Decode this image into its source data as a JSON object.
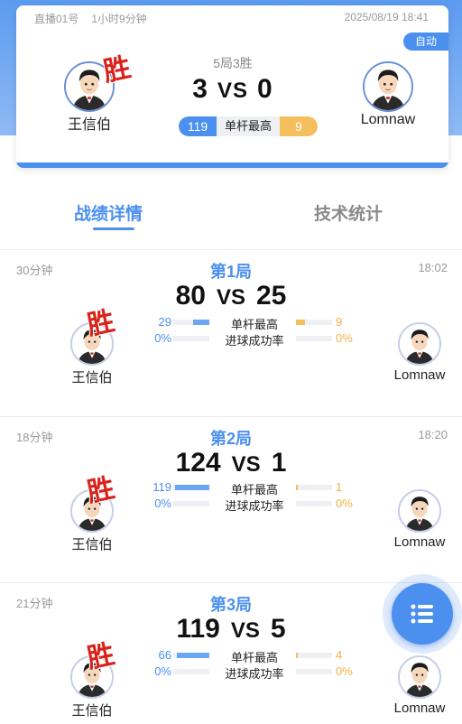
{
  "header": {
    "room": "直播01号",
    "duration": "1小时9分钟",
    "datetime": "2025/08/19 18:41",
    "auto_badge": "自动",
    "format": "5局3胜",
    "score_left": "3",
    "vs": "VS",
    "score_right": "0",
    "break_label": "单杆最高",
    "break_left": "119",
    "break_right": "9",
    "player_left": "王信伯",
    "player_right": "Lomnaw",
    "win_stamp": "胜"
  },
  "tabs": {
    "active": "战绩详情",
    "inactive": "技术统计"
  },
  "labels": {
    "high_break": "单杆最高",
    "pot_rate": "进球成功率",
    "vs": "VS",
    "win": "胜"
  },
  "games": [
    {
      "title": "第1局",
      "duration": "30分钟",
      "time": "18:02",
      "score_left": "80",
      "score_right": "25",
      "break_left": "29",
      "break_right": "9",
      "break_left_fill": 0.45,
      "break_right_fill": 0.25,
      "pot_left": "0%",
      "pot_right": "0%",
      "player_left": "王信伯",
      "player_right": "Lomnaw"
    },
    {
      "title": "第2局",
      "duration": "18分钟",
      "time": "18:20",
      "score_left": "124",
      "score_right": "1",
      "break_left": "119",
      "break_right": "1",
      "break_left_fill": 0.95,
      "break_right_fill": 0.05,
      "pot_left": "0%",
      "pot_right": "0%",
      "player_left": "王信伯",
      "player_right": "Lomnaw"
    },
    {
      "title": "第3局",
      "duration": "21分钟",
      "time": "",
      "score_left": "119",
      "score_right": "5",
      "break_left": "66",
      "break_right": "4",
      "break_left_fill": 0.9,
      "break_right_fill": 0.06,
      "pot_left": "0%",
      "pot_right": "0%",
      "player_left": "王信伯",
      "player_right": "Lomnaw"
    }
  ],
  "colors": {
    "accent": "#4b90ef",
    "win_red": "#d8231b",
    "gold": "#f5bf5e"
  },
  "icons": {
    "fab": "list-icon",
    "avatar": "cartoon-man-avatar"
  }
}
